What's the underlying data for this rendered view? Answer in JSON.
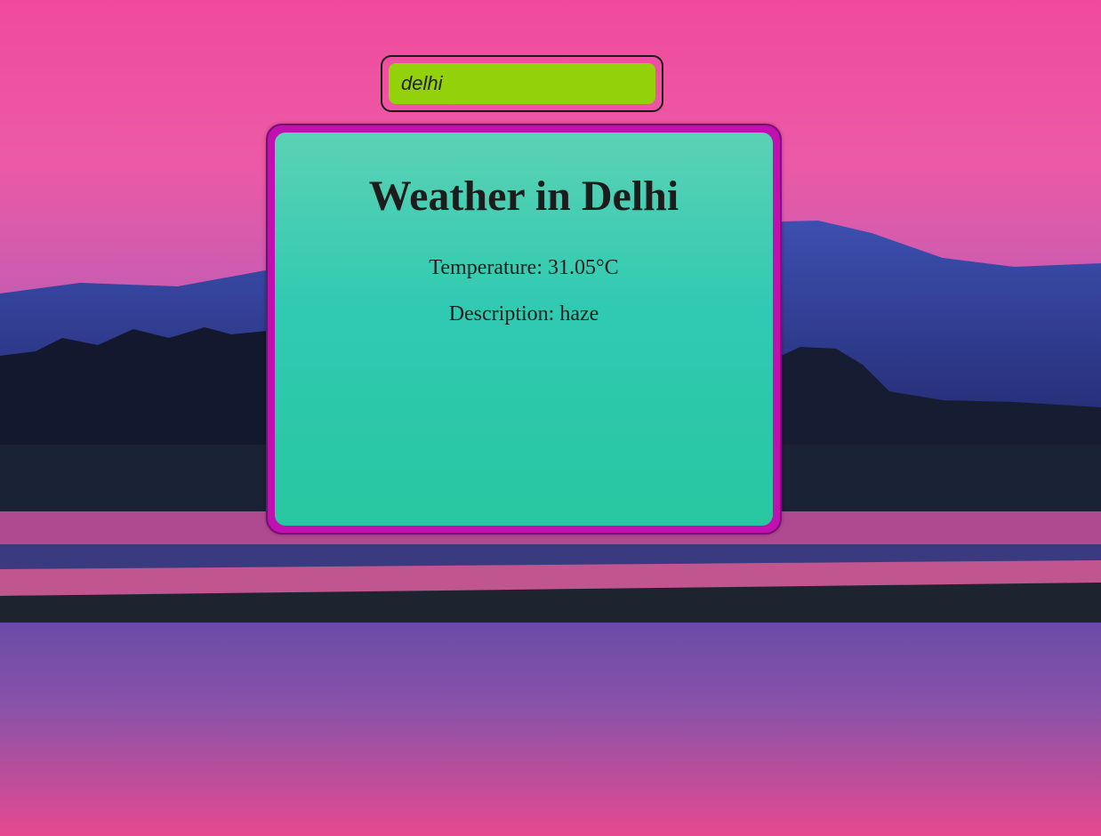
{
  "search": {
    "value": "delhi"
  },
  "weather": {
    "title": "Weather in Delhi",
    "temperature": "Temperature: 31.05°C",
    "description": "Description: haze"
  },
  "colors": {
    "input_bg": "#93d10b",
    "card_border": "#c010b0",
    "card_bg": "#2ad2b0",
    "sky": "#f24fa0"
  },
  "background": {
    "subject": "landscape-photo"
  }
}
